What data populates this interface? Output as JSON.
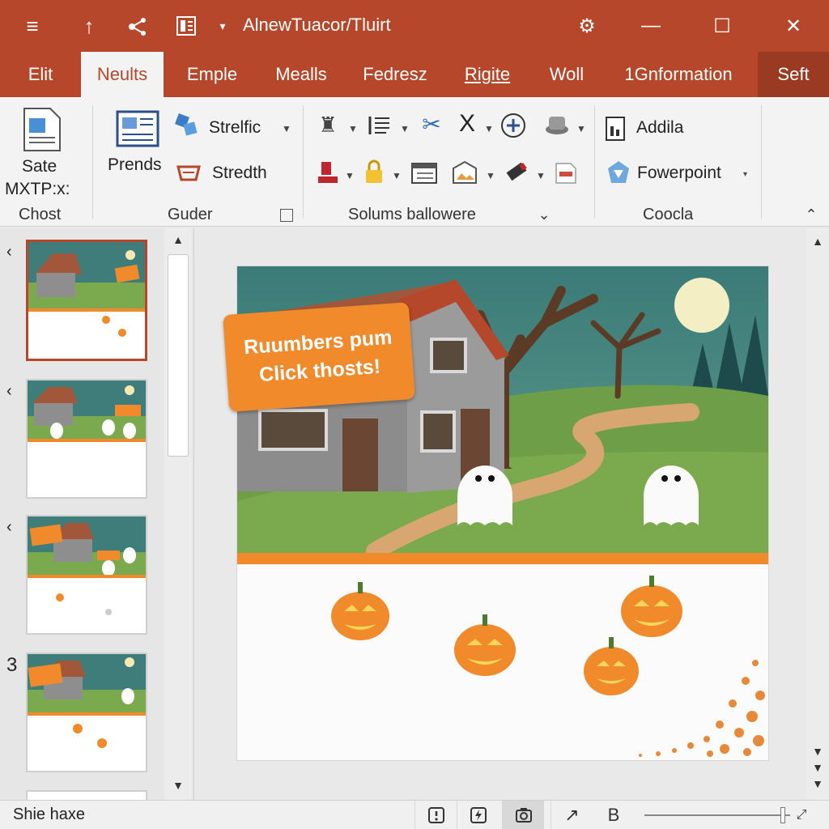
{
  "titlebar": {
    "title": "AlnewTuacor/Tluirt",
    "icons": [
      "menu-icon",
      "upload-icon",
      "share-icon",
      "document-icon",
      "dropdown-icon"
    ],
    "controls": [
      "restore-icon",
      "minimize-icon",
      "maximize-icon",
      "close-icon"
    ]
  },
  "tabs": [
    {
      "label": "Elit"
    },
    {
      "label": "Neults"
    },
    {
      "label": "Emple"
    },
    {
      "label": "Mealls"
    },
    {
      "label": "Fedresz"
    },
    {
      "label": "Rigite"
    },
    {
      "label": "Woll"
    },
    {
      "label": "1Gnformation"
    },
    {
      "label": "Seft"
    }
  ],
  "active_tab": "Neults",
  "ribbon": {
    "group1": {
      "button_label": "Sate",
      "button_sub": "MXTP:x:",
      "group_label": "Chost"
    },
    "group2": {
      "prends": "Prends",
      "strelfic": "Strelfic",
      "stredth": "Stredth",
      "group_label": "Guder"
    },
    "group3": {
      "group_label": "Solums ballowere"
    },
    "group4": {
      "addila": "Addila",
      "powerpoint": "Fowerpoint",
      "group_label": "Coocla"
    }
  },
  "thumbnails": [
    {
      "number": ""
    },
    {
      "number": ""
    },
    {
      "number": ""
    },
    {
      "number": "3"
    }
  ],
  "slide": {
    "banner_line1": "Ruumbers pum",
    "banner_line2": "Click thosts!"
  },
  "statusbar": {
    "text": "Shie haxe",
    "buttons": [
      "notes-icon",
      "flash-icon",
      "camera-icon",
      "share-icon",
      "B",
      "zoom-slider"
    ],
    "zoom_percent": 95
  },
  "colors": {
    "brand": "#b7472a",
    "orange": "#f08a2b",
    "sky": "#3e7d79",
    "grass": "#7aa94e"
  }
}
